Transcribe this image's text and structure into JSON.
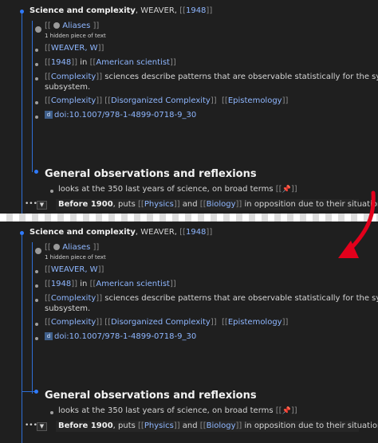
{
  "panels": [
    {
      "note_title": "Science and complexity",
      "note_title_rest": ", WEAVER, ",
      "year": "1948",
      "aliases_label": "Aliases",
      "hidden_text": "1 hidden piece of text",
      "author": "WEAVER, W",
      "year2": "1948",
      "in_text": " in ",
      "occupation": "American scientist",
      "complexity": "Complexity",
      "complexity_desc_1": " sciences describe patterns that are observable statistically for the system as a whole",
      "complexity_desc_2": "subsystem.",
      "tag1": "Complexity",
      "tag2": "Disorganized Complexity",
      "tag3": "Epistemology",
      "doi_icon": "d",
      "doi": "doi:10.1007/978-1-4899-0718-9_30",
      "section_heading": "General observations and reflexions",
      "obs_text": "looks at the 350 last years of science, on broad terms ",
      "before_bold": "Before 1900",
      "before_text": ", puts ",
      "physics": "Physics",
      "and_text": " and ",
      "biology": "Biology",
      "opposition": " in opposition due to their situation "
    },
    {
      "note_title": "Science and complexity",
      "note_title_rest": ", WEAVER, ",
      "year": "1948",
      "aliases_label": "Aliases",
      "hidden_text": "1 hidden piece of text",
      "author": "WEAVER, W",
      "year2": "1948",
      "in_text": " in ",
      "occupation": "American scientist",
      "complexity": "Complexity",
      "complexity_desc_1": " sciences describe patterns that are observable statistically for the system as a whole",
      "complexity_desc_2": "subsystem.",
      "tag1": "Complexity",
      "tag2": "Disorganized Complexity",
      "tag3": "Epistemology",
      "doi_icon": "d",
      "doi": "doi:10.1007/978-1-4899-0718-9_30",
      "section_heading": "General observations and reflexions",
      "obs_text": "looks at the 350 last years of science, on broad terms ",
      "before_bold": "Before 1900",
      "before_text": ", puts ",
      "physics": "Physics",
      "and_text": " and ",
      "biology": "Biology",
      "opposition": " in opposition due to their situation "
    }
  ],
  "symbols": {
    "open": "[[",
    "close": "]]",
    "pin": "📌",
    "dots": "•••",
    "caret": "▼"
  },
  "colors": {
    "accent_blue": "#2f7bff",
    "link": "#8fb7ff",
    "arrow_red": "#e3001b"
  }
}
